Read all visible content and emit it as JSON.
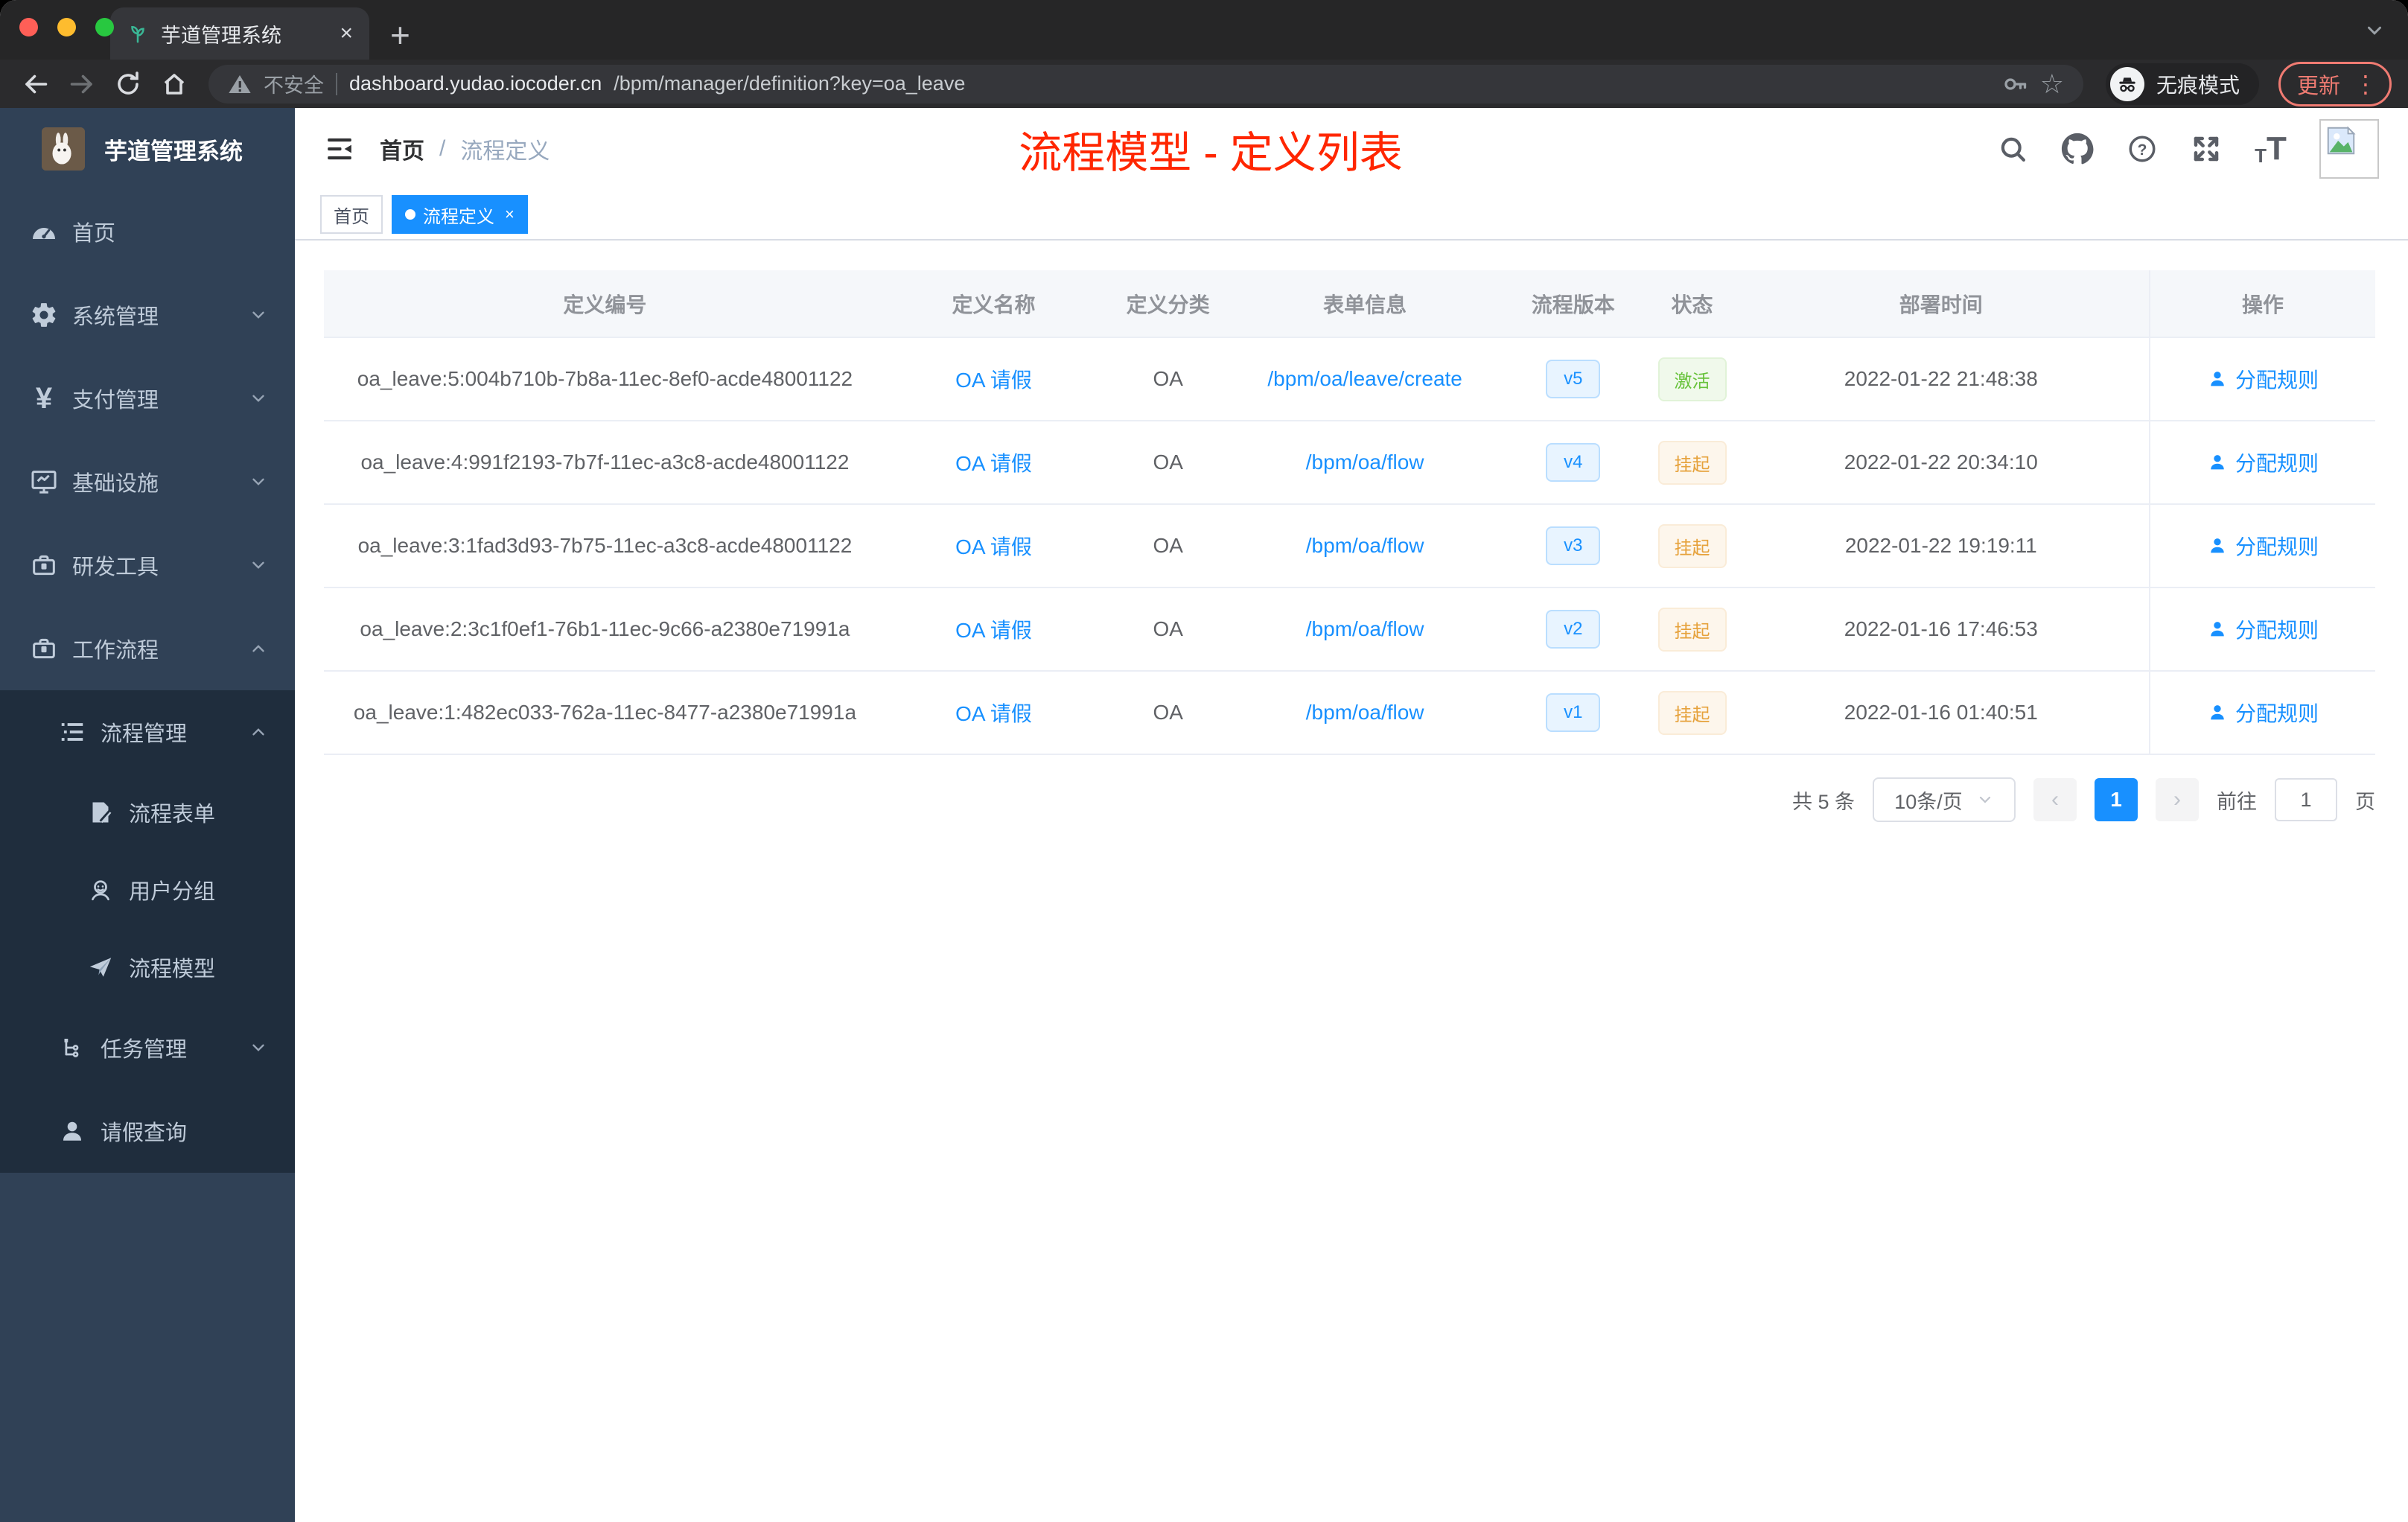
{
  "colors": {
    "primary": "#1890ff",
    "success": "#67c23a",
    "warning": "#e6a23c",
    "title_red": "#ff2600",
    "sidebar_bg": "#304156",
    "submenu_bg": "#1f2d3d",
    "mac_close": "#ff5f57",
    "mac_minimize": "#febc2e",
    "mac_zoom": "#28c840"
  },
  "icons": {
    "tab_close": "×",
    "new_tab": "+",
    "star": "☆",
    "more_vert": "⋮",
    "avatar_caret": "▾",
    "prev": "‹",
    "next": "›",
    "tag_close": "×",
    "help": "?"
  },
  "browser": {
    "tab_title": "芋道管理系统",
    "security_label": "不安全",
    "url_host": "dashboard.yudao.iocoder.cn",
    "url_path": "/bpm/manager/definition?key=oa_leave",
    "incognito_label": "无痕模式",
    "update_label": "更新"
  },
  "sidebar": {
    "logo_title": "芋道管理系统",
    "menu": [
      {
        "label": "首页"
      },
      {
        "label": "系统管理"
      },
      {
        "label": "支付管理"
      },
      {
        "label": "基础设施"
      },
      {
        "label": "研发工具"
      },
      {
        "label": "工作流程"
      }
    ],
    "submenu": [
      {
        "label": "流程管理"
      },
      {
        "label": "流程表单"
      },
      {
        "label": "用户分组"
      },
      {
        "label": "流程模型"
      },
      {
        "label": "任务管理"
      },
      {
        "label": "请假查询"
      }
    ]
  },
  "header": {
    "breadcrumb_home": "首页",
    "breadcrumb_sep": "/",
    "breadcrumb_current": "流程定义",
    "page_title": "流程模型 - 定义列表"
  },
  "tags": {
    "home": "首页",
    "active": "流程定义"
  },
  "table": {
    "columns": [
      "定义编号",
      "定义名称",
      "定义分类",
      "表单信息",
      "流程版本",
      "状态",
      "部署时间",
      "操作"
    ],
    "action_label": "分配规则",
    "rows": [
      {
        "id": "oa_leave:5:004b710b-7b8a-11ec-8ef0-acde48001122",
        "name": "OA 请假",
        "category": "OA",
        "form": "/bpm/oa/leave/create",
        "version": "v5",
        "status": "激活",
        "status_type": "active",
        "deploy_time": "2022-01-22 21:48:38"
      },
      {
        "id": "oa_leave:4:991f2193-7b7f-11ec-a3c8-acde48001122",
        "name": "OA 请假",
        "category": "OA",
        "form": "/bpm/oa/flow",
        "version": "v4",
        "status": "挂起",
        "status_type": "suspended",
        "deploy_time": "2022-01-22 20:34:10"
      },
      {
        "id": "oa_leave:3:1fad3d93-7b75-11ec-a3c8-acde48001122",
        "name": "OA 请假",
        "category": "OA",
        "form": "/bpm/oa/flow",
        "version": "v3",
        "status": "挂起",
        "status_type": "suspended",
        "deploy_time": "2022-01-22 19:19:11"
      },
      {
        "id": "oa_leave:2:3c1f0ef1-76b1-11ec-9c66-a2380e71991a",
        "name": "OA 请假",
        "category": "OA",
        "form": "/bpm/oa/flow",
        "version": "v2",
        "status": "挂起",
        "status_type": "suspended",
        "deploy_time": "2022-01-16 17:46:53"
      },
      {
        "id": "oa_leave:1:482ec033-762a-11ec-8477-a2380e71991a",
        "name": "OA 请假",
        "category": "OA",
        "form": "/bpm/oa/flow",
        "version": "v1",
        "status": "挂起",
        "status_type": "suspended",
        "deploy_time": "2022-01-16 01:40:51"
      }
    ]
  },
  "pagination": {
    "total_text": "共 5 条",
    "page_size": "10条/页",
    "current_page": "1",
    "goto_label": "前往",
    "goto_value": "1",
    "page_suffix": "页"
  }
}
